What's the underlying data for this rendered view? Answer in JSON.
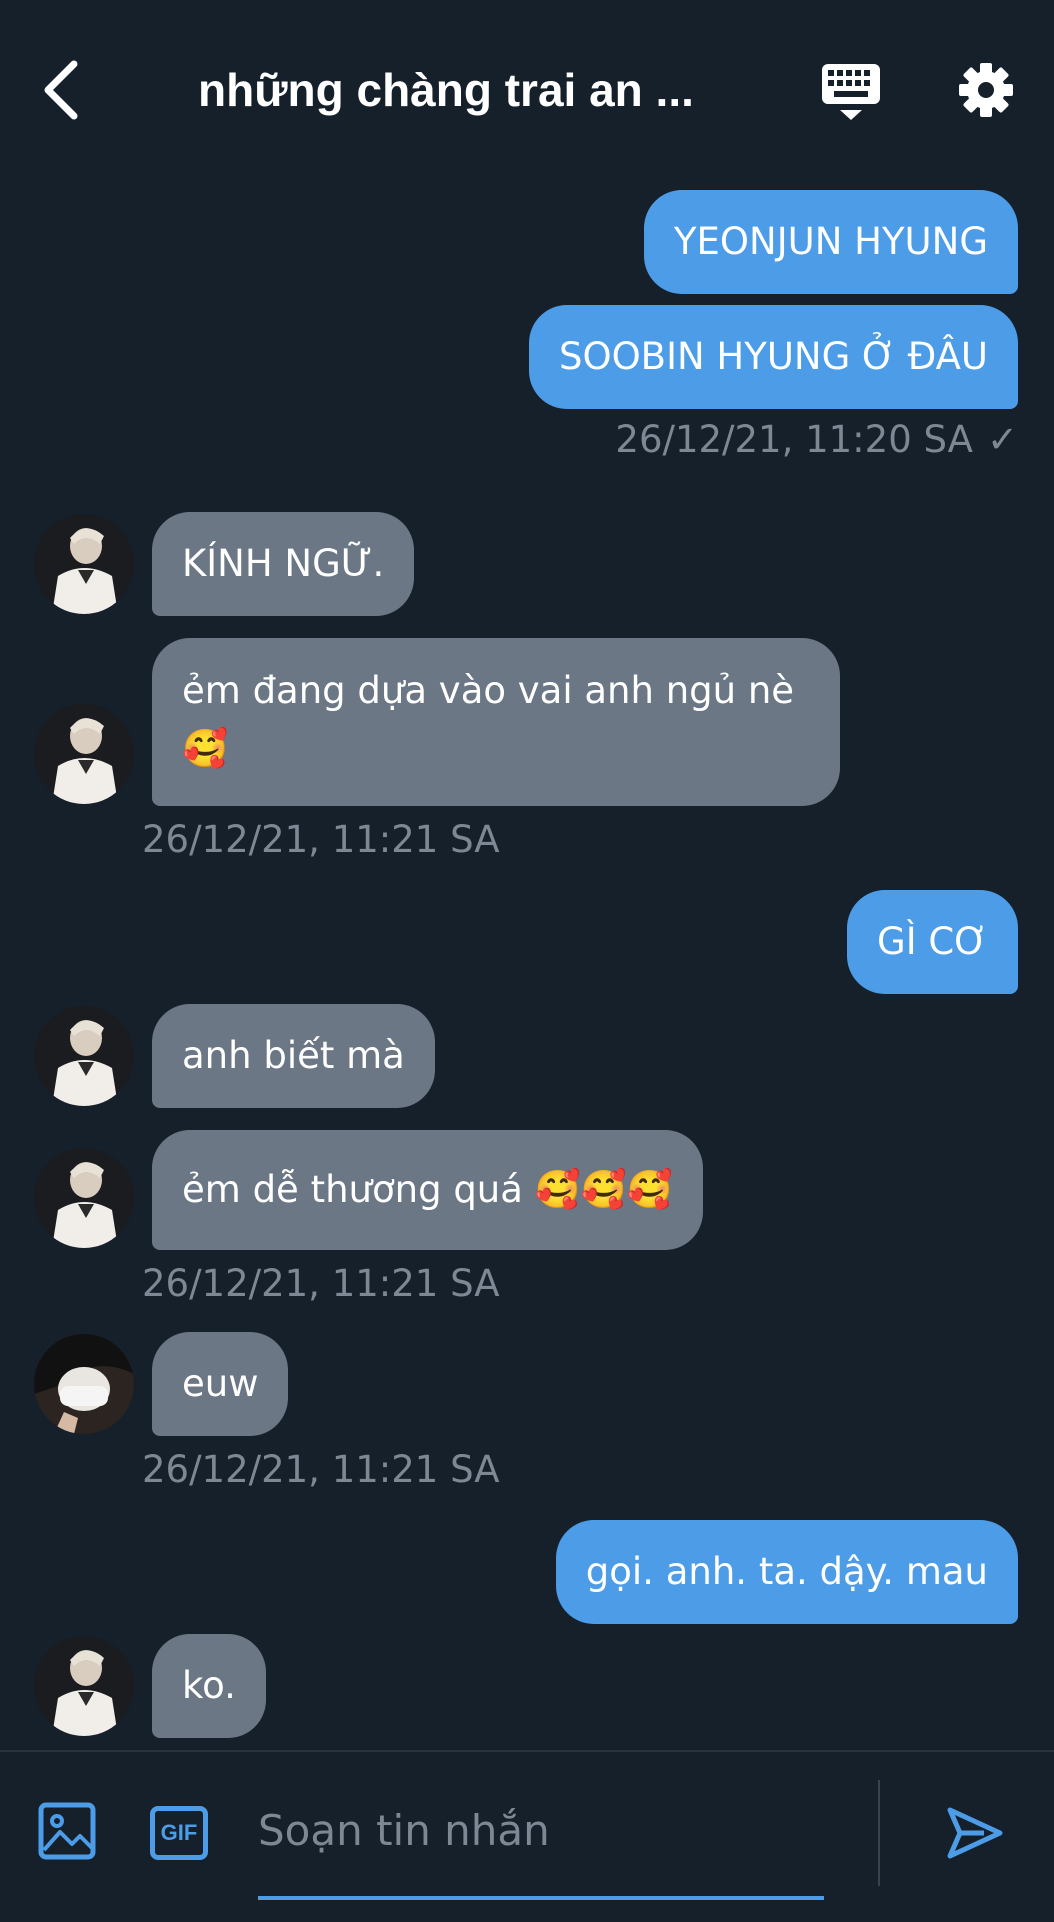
{
  "header": {
    "title": "những chàng trai an ...",
    "back_icon": "chevron-left-icon",
    "keyboard_icon": "keyboard-icon",
    "settings_icon": "gear-icon"
  },
  "messages": [
    {
      "dir": "out",
      "text": "YEONJUN HYUNG"
    },
    {
      "dir": "out",
      "text": "SOOBIN HYUNG Ở ĐÂU"
    },
    {
      "dir": "out",
      "timestamp": "26/12/21, 11:20 SA",
      "check": "✓"
    },
    {
      "dir": "in",
      "text": "KÍNH NGỮ."
    },
    {
      "dir": "in",
      "text": "ẻm đang dựa vào vai anh ngủ nè 🥰"
    },
    {
      "dir": "in",
      "timestamp": "26/12/21, 11:21 SA"
    },
    {
      "dir": "out",
      "text": "GÌ CƠ"
    },
    {
      "dir": "in",
      "text": "anh biết mà"
    },
    {
      "dir": "in",
      "text": "ẻm dễ thương quá 🥰🥰🥰"
    },
    {
      "dir": "in",
      "timestamp": "26/12/21, 11:21 SA"
    },
    {
      "dir": "in",
      "text": "euw"
    },
    {
      "dir": "in",
      "timestamp": "26/12/21, 11:21 SA"
    },
    {
      "dir": "out",
      "text": "gọi. anh. ta. dậy. mau"
    },
    {
      "dir": "in",
      "text": "ko."
    }
  ],
  "composer": {
    "placeholder": "Soạn tin nhắn",
    "gif_label": "GIF",
    "image_icon": "image-icon",
    "send_icon": "send-icon"
  },
  "colors": {
    "background": "#15202b",
    "outgoing_bubble": "#4c9ce8",
    "incoming_bubble": "#6b7785",
    "timestamp": "#7d8894",
    "accent": "#4c9ce8"
  }
}
